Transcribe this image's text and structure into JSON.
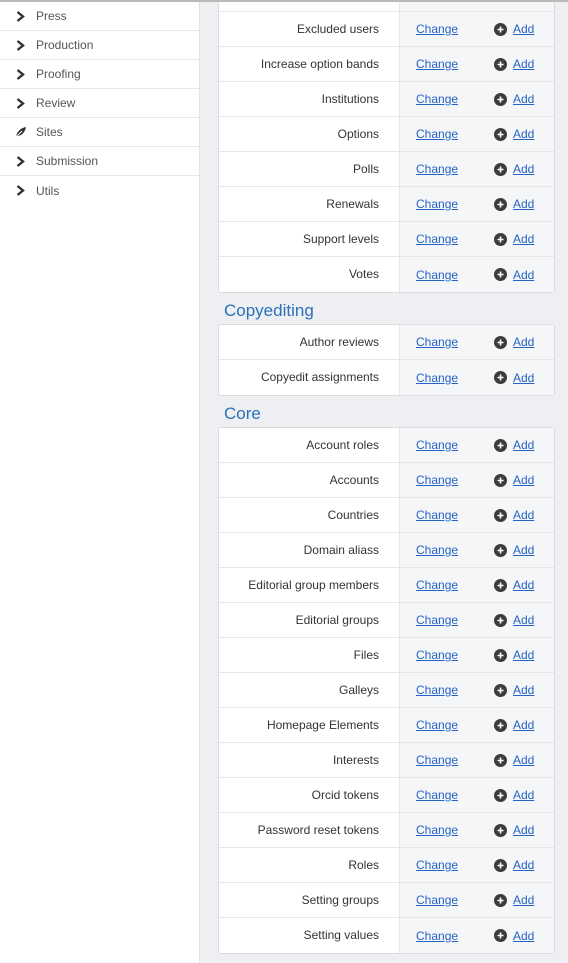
{
  "sidebar": {
    "items": [
      {
        "label": "Press",
        "icon": "chevron-right-icon"
      },
      {
        "label": "Production",
        "icon": "chevron-right-icon"
      },
      {
        "label": "Proofing",
        "icon": "chevron-right-icon"
      },
      {
        "label": "Review",
        "icon": "chevron-right-icon"
      },
      {
        "label": "Sites",
        "icon": "leaf-icon"
      },
      {
        "label": "Submission",
        "icon": "chevron-right-icon"
      },
      {
        "label": "Utils",
        "icon": "chevron-right-icon"
      }
    ]
  },
  "actions": {
    "change_label": "Change",
    "add_label": "Add"
  },
  "sections": [
    {
      "title": "",
      "rows": [
        "Excluded users",
        "Increase option bands",
        "Institutions",
        "Options",
        "Polls",
        "Renewals",
        "Support levels",
        "Votes"
      ]
    },
    {
      "title": "Copyediting",
      "rows": [
        "Author reviews",
        "Copyedit assignments"
      ]
    },
    {
      "title": "Core",
      "rows": [
        "Account roles",
        "Accounts",
        "Countries",
        "Domain aliass",
        "Editorial group members",
        "Editorial groups",
        "Files",
        "Galleys",
        "Homepage Elements",
        "Interests",
        "Orcid tokens",
        "Password reset tokens",
        "Roles",
        "Setting groups",
        "Setting values"
      ]
    }
  ],
  "colors": {
    "section_title": "#2c6fba",
    "link": "#2563c4",
    "background": "#edeff3"
  }
}
